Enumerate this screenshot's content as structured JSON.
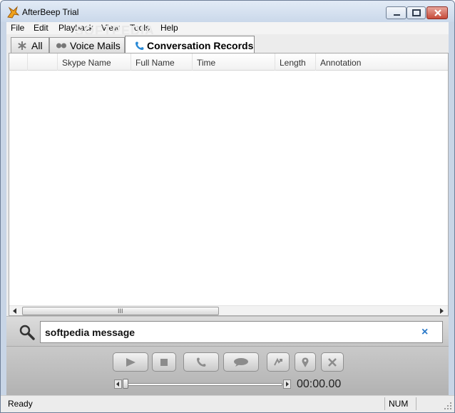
{
  "window": {
    "title": "AfterBeep Trial"
  },
  "menu": [
    "File",
    "Edit",
    "Playback",
    "View",
    "Tools",
    "Help"
  ],
  "watermark": "SOFTPEDIA",
  "tabs": [
    {
      "label": "All",
      "icon": "asterisk-icon"
    },
    {
      "label": "Voice Mails",
      "icon": "voicemail-icon"
    },
    {
      "label": "Conversation Records",
      "icon": "phone-icon"
    }
  ],
  "columns": [
    "Skype Name",
    "Full Name",
    "Time",
    "Length",
    "Annotation"
  ],
  "scrollbar": {
    "grip": "III"
  },
  "search": {
    "value": "softpedia message",
    "clear": "×"
  },
  "player": {
    "time": "00:00.00",
    "position": 0
  },
  "status": {
    "text": "Ready",
    "num": "NUM"
  }
}
